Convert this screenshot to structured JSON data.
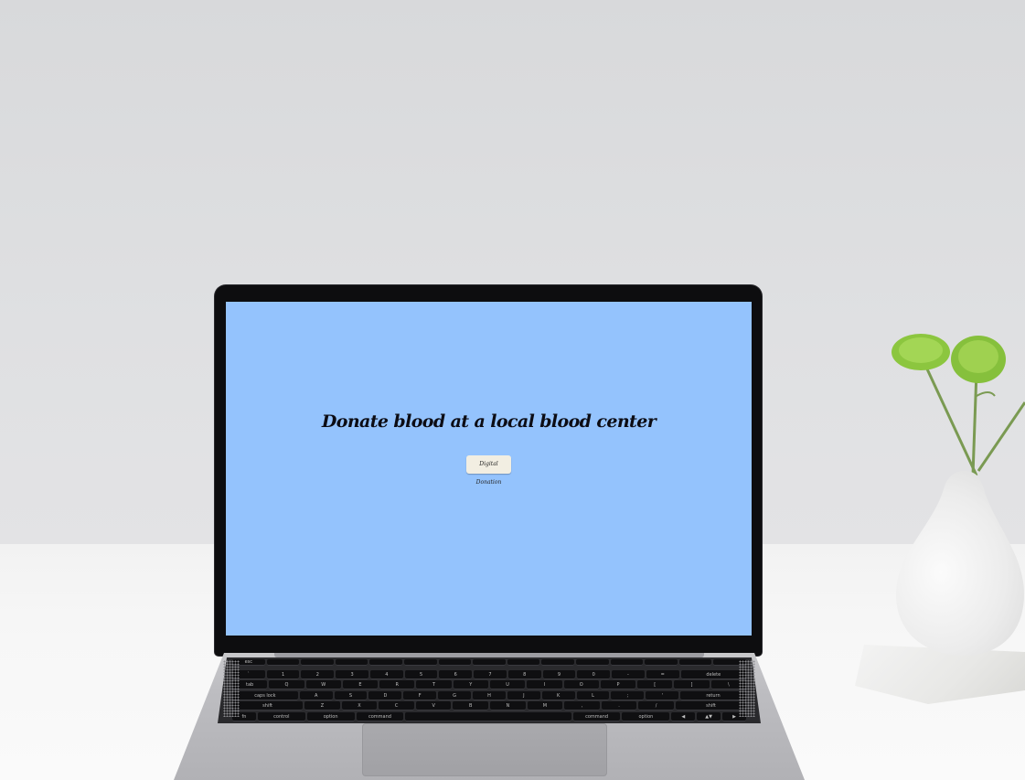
{
  "screen": {
    "background": "#94c3fd",
    "headline": "Donate blood at a local blood center",
    "button_label": "Digital Donation"
  },
  "keyboard": {
    "rows": [
      [
        "esc",
        "",
        "",
        "",
        "",
        "",
        "",
        "",
        "",
        "",
        "",
        "",
        "",
        "",
        ""
      ],
      [
        "`",
        "1",
        "2",
        "3",
        "4",
        "5",
        "6",
        "7",
        "8",
        "9",
        "0",
        "-",
        "=",
        "delete"
      ],
      [
        "tab",
        "Q",
        "W",
        "E",
        "R",
        "T",
        "Y",
        "U",
        "I",
        "O",
        "P",
        "[",
        "]",
        "\\"
      ],
      [
        "caps lock",
        "A",
        "S",
        "D",
        "F",
        "G",
        "H",
        "J",
        "K",
        "L",
        ";",
        "'",
        "return"
      ],
      [
        "shift",
        "Z",
        "X",
        "C",
        "V",
        "B",
        "N",
        "M",
        ",",
        ".",
        "/",
        "shift"
      ],
      [
        "fn",
        "control",
        "option",
        "command",
        "",
        "command",
        "option",
        "◀",
        "▲▼",
        "▶"
      ]
    ]
  }
}
